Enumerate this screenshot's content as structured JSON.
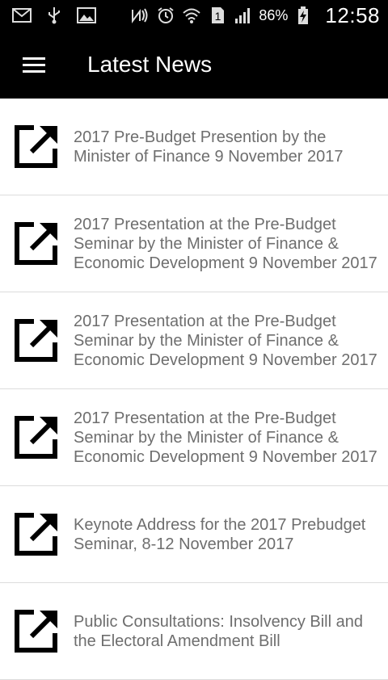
{
  "status_bar": {
    "battery_percent": "86%",
    "time": "12:58",
    "sim_slot": "1",
    "icons": [
      "mail-icon",
      "usb-icon",
      "image-icon",
      "nfc-icon",
      "alarm-icon",
      "wifi-icon",
      "sim-icon",
      "signal-icon",
      "battery-charging-icon"
    ]
  },
  "app_bar": {
    "title": "Latest News",
    "menu_icon": "hamburger-menu-icon"
  },
  "news": {
    "item_icon": "open-external-icon",
    "items": [
      {
        "title": "2017 Pre-Budget Presention by the Minister of Finance 9 November 2017"
      },
      {
        "title": "2017 Presentation at the Pre-Budget Seminar by the Minister of Finance & Economic Development 9 November 2017"
      },
      {
        "title": "2017 Presentation at the Pre-Budget Seminar by the Minister of Finance & Economic Development 9 November 2017"
      },
      {
        "title": "2017 Presentation at the Pre-Budget Seminar by the Minister of Finance & Economic Development 9 November 2017"
      },
      {
        "title": "Keynote Address for the 2017 Prebudget Seminar, 8-12 November 2017"
      },
      {
        "title": "Public Consultations: Insolvency Bill and the Electoral Amendment Bill"
      }
    ]
  },
  "colors": {
    "app_bar_bg": "#000000",
    "item_text": "#6e6e6e",
    "divider": "#dcdcdc"
  }
}
